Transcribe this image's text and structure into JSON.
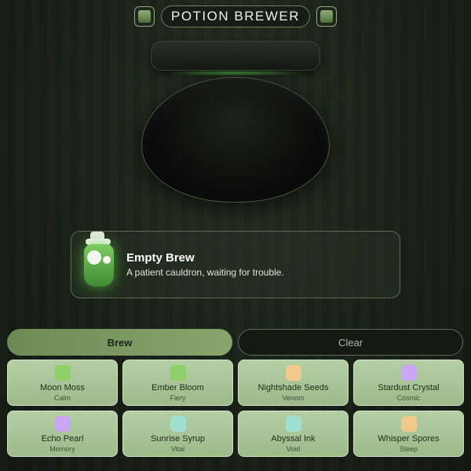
{
  "header": {
    "title": "POTION BREWER"
  },
  "brew": {
    "name": "Empty Brew",
    "description": "A patient cauldron, waiting for trouble."
  },
  "actions": {
    "brew_label": "Brew",
    "clear_label": "Clear"
  },
  "ingredients": [
    {
      "name": "Moon Moss",
      "effect": "Calm",
      "color": "#8fd06a"
    },
    {
      "name": "Ember Bloom",
      "effect": "Fiery",
      "color": "#8fd06a"
    },
    {
      "name": "Nightshade Seeds",
      "effect": "Venom",
      "color": "#f1c98c"
    },
    {
      "name": "Stardust Crystal",
      "effect": "Cosmic",
      "color": "#c9a7f2"
    },
    {
      "name": "Echo Pearl",
      "effect": "Memory",
      "color": "#c9a7f2"
    },
    {
      "name": "Sunrise Syrup",
      "effect": "Vital",
      "color": "#9fe0d2"
    },
    {
      "name": "Abyssal Ink",
      "effect": "Void",
      "color": "#9fe0d2"
    },
    {
      "name": "Whisper Spores",
      "effect": "Sleep",
      "color": "#f1c98c"
    }
  ]
}
